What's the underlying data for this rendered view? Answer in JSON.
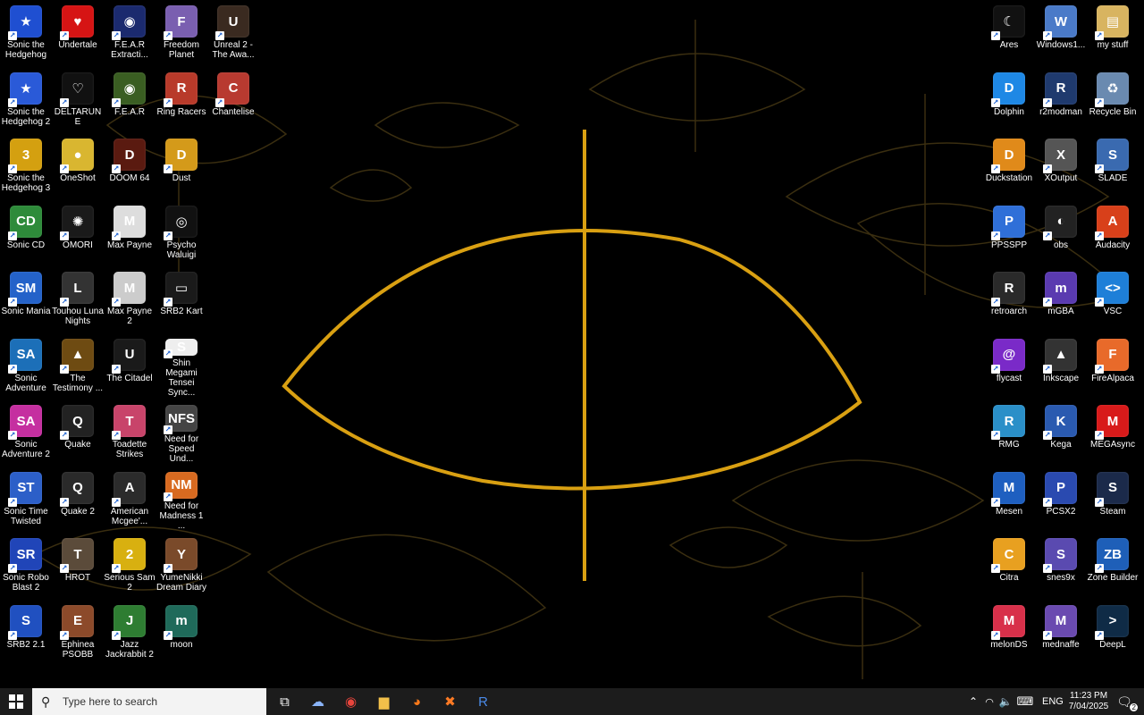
{
  "desktop": {
    "icons": [
      {
        "label": "Sonic the Hedgehog",
        "col": 0,
        "row": 0,
        "color": "#1f4fd1",
        "glyph": "★"
      },
      {
        "label": "Sonic the Hedgehog 2",
        "col": 0,
        "row": 1,
        "color": "#2a5ad8",
        "glyph": "★"
      },
      {
        "label": "Sonic the Hedgehog 3",
        "col": 0,
        "row": 2,
        "color": "#d4a010",
        "glyph": "3"
      },
      {
        "label": "Sonic CD",
        "col": 0,
        "row": 3,
        "color": "#2e8b3a",
        "glyph": "CD"
      },
      {
        "label": "Sonic Mania",
        "col": 0,
        "row": 4,
        "color": "#2462c9",
        "glyph": "SM"
      },
      {
        "label": "Sonic Adventure",
        "col": 0,
        "row": 5,
        "color": "#1c6fb8",
        "glyph": "SA"
      },
      {
        "label": "Sonic Adventure 2",
        "col": 0,
        "row": 6,
        "color": "#c52fa0",
        "glyph": "SA"
      },
      {
        "label": "Sonic Time Twisted",
        "col": 0,
        "row": 7,
        "color": "#2c5fc8",
        "glyph": "ST"
      },
      {
        "label": "Sonic Robo Blast 2",
        "col": 0,
        "row": 8,
        "color": "#2045b8",
        "glyph": "SR"
      },
      {
        "label": "SRB2 2.1",
        "col": 0,
        "row": 9,
        "color": "#2050c0",
        "glyph": "S"
      },
      {
        "label": "Undertale",
        "col": 1,
        "row": 0,
        "color": "#d61414",
        "glyph": "♥"
      },
      {
        "label": "DELTARUNE",
        "col": 1,
        "row": 1,
        "color": "#111111",
        "glyph": "♡"
      },
      {
        "label": "OneShot",
        "col": 1,
        "row": 2,
        "color": "#d9b630",
        "glyph": "●"
      },
      {
        "label": "OMORI",
        "col": 1,
        "row": 3,
        "color": "#1a1a1a",
        "glyph": "✺"
      },
      {
        "label": "Touhou Luna Nights",
        "col": 1,
        "row": 4,
        "color": "#333333",
        "glyph": "L"
      },
      {
        "label": "The Testimony ...",
        "col": 1,
        "row": 5,
        "color": "#6e4b12",
        "glyph": "▲"
      },
      {
        "label": "Quake",
        "col": 1,
        "row": 6,
        "color": "#222222",
        "glyph": "Q"
      },
      {
        "label": "Quake 2",
        "col": 1,
        "row": 7,
        "color": "#2a2a2a",
        "glyph": "Q"
      },
      {
        "label": "HROT",
        "col": 1,
        "row": 8,
        "color": "#5b4b3a",
        "glyph": "T"
      },
      {
        "label": "Ephinea PSOBB",
        "col": 1,
        "row": 9,
        "color": "#8c4a2a",
        "glyph": "E"
      },
      {
        "label": "F.E.A.R Extracti...",
        "col": 2,
        "row": 0,
        "color": "#1b2a6e",
        "glyph": "◉"
      },
      {
        "label": "F.E.A.R",
        "col": 2,
        "row": 1,
        "color": "#3a5e22",
        "glyph": "◉"
      },
      {
        "label": "DOOM 64",
        "col": 2,
        "row": 2,
        "color": "#5a1a10",
        "glyph": "D"
      },
      {
        "label": "Max Payne",
        "col": 2,
        "row": 3,
        "color": "#dddddd",
        "glyph": "M"
      },
      {
        "label": "Max Payne 2",
        "col": 2,
        "row": 4,
        "color": "#cccccc",
        "glyph": "M"
      },
      {
        "label": "The Citadel",
        "col": 2,
        "row": 5,
        "color": "#1a1a1a",
        "glyph": "U"
      },
      {
        "label": "Toadette Strikes",
        "col": 2,
        "row": 6,
        "color": "#c8446a",
        "glyph": "T"
      },
      {
        "label": "American Mcgee'...",
        "col": 2,
        "row": 7,
        "color": "#2b2b2b",
        "glyph": "A"
      },
      {
        "label": "Serious Sam 2",
        "col": 2,
        "row": 8,
        "color": "#d8b010",
        "glyph": "2"
      },
      {
        "label": "Jazz Jackrabbit 2",
        "col": 2,
        "row": 9,
        "color": "#2e7d32",
        "glyph": "J"
      },
      {
        "label": "Freedom Planet",
        "col": 3,
        "row": 0,
        "color": "#7a5fb0",
        "glyph": "F"
      },
      {
        "label": "Ring Racers",
        "col": 3,
        "row": 1,
        "color": "#b83a2a",
        "glyph": "R"
      },
      {
        "label": "Dust",
        "col": 3,
        "row": 2,
        "color": "#d49a1a",
        "glyph": "D"
      },
      {
        "label": "Psycho Waluigi",
        "col": 3,
        "row": 3,
        "color": "#111111",
        "glyph": "◎"
      },
      {
        "label": "SRB2 Kart",
        "col": 3,
        "row": 4,
        "color": "#1a1a1a",
        "glyph": "▭"
      },
      {
        "label": "Shin Megami Tensei Sync...",
        "col": 3,
        "row": 5,
        "color": "#eeeeee",
        "glyph": "S"
      },
      {
        "label": "Need for Speed Und...",
        "col": 3,
        "row": 6,
        "color": "#444444",
        "glyph": "NFS"
      },
      {
        "label": "Need for Madness 1 ...",
        "col": 3,
        "row": 7,
        "color": "#d86a20",
        "glyph": "NM"
      },
      {
        "label": "YumeNikki Dream Diary",
        "col": 3,
        "row": 8,
        "color": "#7a4a2a",
        "glyph": "Y"
      },
      {
        "label": "moon",
        "col": 3,
        "row": 9,
        "color": "#1f6a5a",
        "glyph": "m"
      },
      {
        "label": "Unreal 2 - The Awa...",
        "col": 4,
        "row": 0,
        "color": "#3a2a20",
        "glyph": "U"
      },
      {
        "label": "Chantelise",
        "col": 4,
        "row": 1,
        "color": "#b83a30",
        "glyph": "C"
      }
    ],
    "right_icons": [
      {
        "label": "Ares",
        "col": 0,
        "row": 0,
        "color": "#111111",
        "glyph": "☾"
      },
      {
        "label": "Dolphin",
        "col": 0,
        "row": 1,
        "color": "#1e88e5",
        "glyph": "D"
      },
      {
        "label": "Duckstation",
        "col": 0,
        "row": 2,
        "color": "#e08a1a",
        "glyph": "D"
      },
      {
        "label": "PPSSPP",
        "col": 0,
        "row": 3,
        "color": "#2f6fd8",
        "glyph": "P"
      },
      {
        "label": "retroarch",
        "col": 0,
        "row": 4,
        "color": "#2a2a2a",
        "glyph": "R"
      },
      {
        "label": "flycast",
        "col": 0,
        "row": 5,
        "color": "#7a2ac8",
        "glyph": "@"
      },
      {
        "label": "RMG",
        "col": 0,
        "row": 6,
        "color": "#2a8fc8",
        "glyph": "R"
      },
      {
        "label": "Mesen",
        "col": 0,
        "row": 7,
        "color": "#1e5fc0",
        "glyph": "M"
      },
      {
        "label": "Citra",
        "col": 0,
        "row": 8,
        "color": "#e8a020",
        "glyph": "C"
      },
      {
        "label": "melonDS",
        "col": 0,
        "row": 9,
        "color": "#d8304a",
        "glyph": "M"
      },
      {
        "label": "Windows1...",
        "col": 1,
        "row": 0,
        "color": "#4a7ac8",
        "glyph": "W"
      },
      {
        "label": "r2modman",
        "col": 1,
        "row": 1,
        "color": "#1f3a6e",
        "glyph": "R"
      },
      {
        "label": "XOutput",
        "col": 1,
        "row": 2,
        "color": "#555555",
        "glyph": "X"
      },
      {
        "label": "obs",
        "col": 1,
        "row": 3,
        "color": "#222222",
        "glyph": "◐"
      },
      {
        "label": "mGBA",
        "col": 1,
        "row": 4,
        "color": "#5a3ab0",
        "glyph": "m"
      },
      {
        "label": "Inkscape",
        "col": 1,
        "row": 5,
        "color": "#333333",
        "glyph": "▲"
      },
      {
        "label": "Kega",
        "col": 1,
        "row": 6,
        "color": "#2a5ab0",
        "glyph": "K"
      },
      {
        "label": "PCSX2",
        "col": 1,
        "row": 7,
        "color": "#2a4ab0",
        "glyph": "P"
      },
      {
        "label": "snes9x",
        "col": 1,
        "row": 8,
        "color": "#5a4ab0",
        "glyph": "S"
      },
      {
        "label": "mednaffe",
        "col": 1,
        "row": 9,
        "color": "#6a4ab0",
        "glyph": "M"
      },
      {
        "label": "my stuff",
        "col": 2,
        "row": 0,
        "color": "#d8b460",
        "glyph": "▤"
      },
      {
        "label": "Recycle Bin",
        "col": 2,
        "row": 1,
        "color": "#6a8ab0",
        "glyph": "♻"
      },
      {
        "label": "SLADE",
        "col": 2,
        "row": 2,
        "color": "#3a6ab0",
        "glyph": "S"
      },
      {
        "label": "Audacity",
        "col": 2,
        "row": 3,
        "color": "#d8401a",
        "glyph": "A"
      },
      {
        "label": "VSC",
        "col": 2,
        "row": 4,
        "color": "#1e7fd8",
        "glyph": "<>"
      },
      {
        "label": "FireAlpaca",
        "col": 2,
        "row": 5,
        "color": "#e86a2a",
        "glyph": "F"
      },
      {
        "label": "MEGAsync",
        "col": 2,
        "row": 6,
        "color": "#d81a1a",
        "glyph": "M"
      },
      {
        "label": "Steam",
        "col": 2,
        "row": 7,
        "color": "#1b2a4a",
        "glyph": "S"
      },
      {
        "label": "Zone Builder",
        "col": 2,
        "row": 8,
        "color": "#1e5fb8",
        "glyph": "ZB"
      },
      {
        "label": "DeepL",
        "col": 2,
        "row": 9,
        "color": "#0f2b46",
        "glyph": ">"
      }
    ]
  },
  "taskbar": {
    "search_placeholder": "Type here to search",
    "pinned": [
      {
        "name": "task-view-button",
        "glyph": "⧉",
        "color": "#ffffff"
      },
      {
        "name": "app-pinned-1",
        "glyph": "☁",
        "color": "#8ab4f8"
      },
      {
        "name": "chrome-button",
        "glyph": "◉",
        "color": "#e8453c"
      },
      {
        "name": "file-explorer-button",
        "glyph": "▆",
        "color": "#f2c04a"
      },
      {
        "name": "firefox-button",
        "glyph": "◕",
        "color": "#ff7a1a"
      },
      {
        "name": "xampp-button",
        "glyph": "✖",
        "color": "#fb7a24"
      },
      {
        "name": "r2modman-taskbar-button",
        "glyph": "R",
        "color": "#4a8ae8"
      }
    ],
    "tray": {
      "language": "ENG",
      "time": "11:23 PM",
      "date": "7/04/2025",
      "notification_count": "2"
    }
  }
}
